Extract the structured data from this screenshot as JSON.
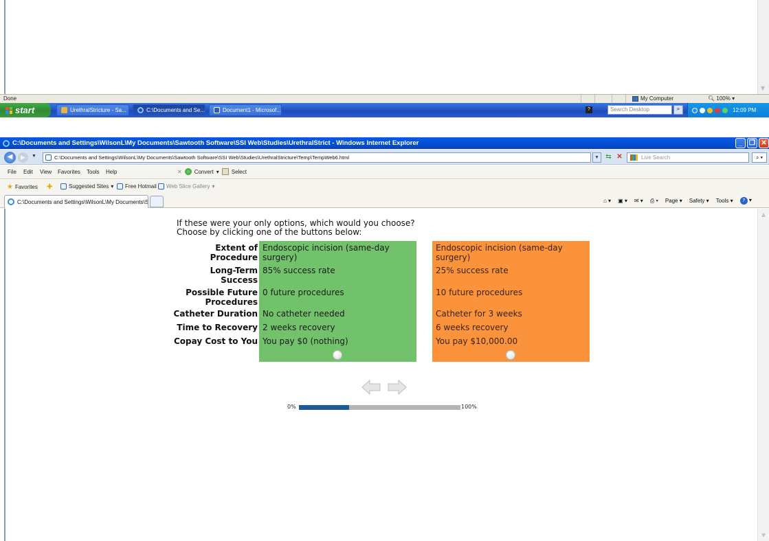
{
  "top_window": {
    "status": "Done",
    "zone": "My Computer",
    "zoom": "100%"
  },
  "taskbar": {
    "start_label": "start",
    "tasks": [
      {
        "label": "UrethralStricture - Sa..."
      },
      {
        "label": "C:\\Documents and Se..."
      },
      {
        "label": "Document1 - Microsof..."
      }
    ],
    "search_placeholder": "Search Desktop",
    "clock": "12:09 PM"
  },
  "ie": {
    "title": "C:\\Documents and Settings\\WilsonL\\My Documents\\Sawtooth Software\\SSI Web\\Studies\\UrethralStrict - Windows Internet Explorer",
    "address": "C:\\Documents and Settings\\WilsonL\\My Documents\\Sawtooth Software\\SSI Web\\Studies\\UrethralStricture\\Temp\\TempWeb6.html",
    "live_search_placeholder": "Live Search",
    "menu": [
      "File",
      "Edit",
      "View",
      "Favorites",
      "Tools",
      "Help"
    ],
    "convert_label": "Convert",
    "select_label": "Select",
    "favorites": {
      "favorites_label": "Favorites",
      "suggested": "Suggested Sites",
      "hotmail": "Free Hotmail",
      "gallery": "Web Slice Gallery"
    },
    "tab_title": "C:\\Documents and Settings\\WilsonL\\My Documents\\S...",
    "commands": {
      "page": "Page",
      "safety": "Safety",
      "tools": "Tools"
    }
  },
  "survey": {
    "question_line1": "If these were your only options, which would you choose?",
    "question_line2": "Choose by clicking one of the buttons below:",
    "attributes": [
      "Extent of Procedure",
      "Long-Term Success",
      "Possible Future Procedures",
      "Catheter Duration",
      "Time to Recovery",
      "Copay Cost to You"
    ],
    "option_a": {
      "color": "#72c26c",
      "values": [
        "Endoscopic incision (same-day surgery)",
        "85% success rate",
        "0 future procedures",
        "No catheter needed",
        "2 weeks recovery",
        "You pay $0 (nothing)"
      ]
    },
    "option_b": {
      "color": "#fb923c",
      "values": [
        "Endoscopic incision (same-day surgery)",
        "25% success rate",
        "10 future procedures",
        "Catheter for 3 weeks",
        "6 weeks recovery",
        "You pay $10,000.00"
      ]
    },
    "progress": {
      "label_start": "0%",
      "label_end": "100%",
      "fraction": 0.31
    }
  }
}
